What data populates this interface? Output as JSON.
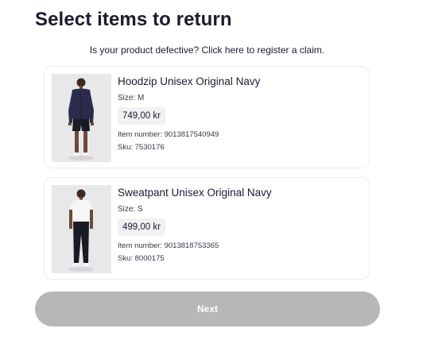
{
  "page": {
    "title": "Select items to return",
    "claim_text": "Is your product defective? Click here to register a claim."
  },
  "items": [
    {
      "name": "Hoodzip Unisex Original Navy",
      "size": "Size: M",
      "price": "749,00 kr",
      "item_number": "Item number: 9013817540949",
      "sku": "Sku: 7530176"
    },
    {
      "name": "Sweatpant Unisex Original Navy",
      "size": "Size: S",
      "price": "499,00 kr",
      "item_number": "Item number: 9013818753365",
      "sku": "Sku: 8000175"
    }
  ],
  "footer": {
    "next_label": "Next",
    "next_enabled": false
  },
  "colors": {
    "text": "#1d1b2e",
    "button_disabled": "#b7b7b7",
    "price_bg": "#f1f1f3",
    "card_border": "#ececf0"
  },
  "icons": [
    "product-photo-hoodie",
    "product-photo-sweatpant"
  ]
}
